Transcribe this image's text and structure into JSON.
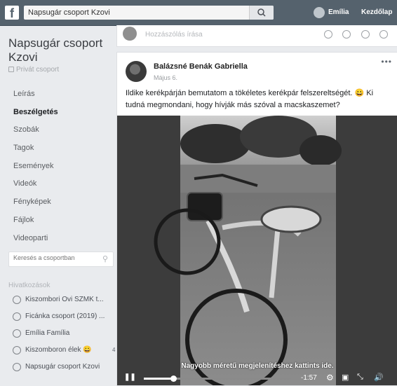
{
  "topbar": {
    "search_value": "Napsugár csoport Kzovi",
    "user_name": "Emília",
    "home_label": "Kezdőlap"
  },
  "sidebar": {
    "group_name": "Napsugár csoport Kzovi",
    "privacy": "Privát csoport",
    "nav": [
      "Leírás",
      "Beszélgetés",
      "Szobák",
      "Tagok",
      "Események",
      "Videók",
      "Fényképek",
      "Fájlok",
      "Videoparti"
    ],
    "active_nav": "Beszélgetés",
    "group_search_placeholder": "Keresés a csoportban",
    "shortcuts_title": "Hivatkozások",
    "shortcuts": [
      {
        "label": "Kiszombori Ovi SZMK t...",
        "badge": ""
      },
      {
        "label": "Ficánka csoport (2019) ...",
        "badge": ""
      },
      {
        "label": "Emília Família",
        "badge": ""
      },
      {
        "label": "Kiszomboron élek 😀",
        "badge": "4"
      },
      {
        "label": "Napsugár csoport Kzovi",
        "badge": ""
      }
    ]
  },
  "composer": {
    "placeholder": "Hozzászólás írása"
  },
  "post": {
    "author": "Balázsné Benák Gabriella",
    "date": "Május 6.",
    "text": "Ildike kerékpárján bemutatom a tökéletes kerékpár felszereltségét. 😀 Ki tudná megmondani, hogy hívják más szóval a macskaszemet?",
    "video": {
      "caption": "Nagyobb méretű megjelenítéshez kattints ide.",
      "time": "-1:57",
      "progress": 0.2
    }
  }
}
